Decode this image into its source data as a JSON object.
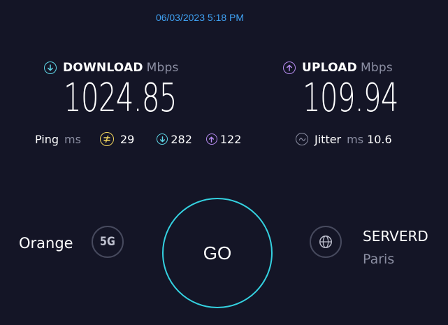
{
  "timestamp": "06/03/2023 5:18 PM",
  "download": {
    "label": "DOWNLOAD",
    "unit": "Mbps",
    "value": "1024.85",
    "icon": "arrow-down-circle-icon",
    "color": "#5fd6e6"
  },
  "upload": {
    "label": "UPLOAD",
    "unit": "Mbps",
    "value": "109.94",
    "icon": "arrow-up-circle-icon",
    "color": "#b68cf0"
  },
  "ping": {
    "label": "Ping",
    "unit": "ms",
    "idle_value": "29",
    "idle_icon": "idle-latency-icon",
    "idle_color": "#f1d55e",
    "download_value": "282",
    "upload_value": "122"
  },
  "jitter": {
    "label": "Jitter",
    "unit": "ms",
    "value": "10.6",
    "icon": "wave-icon"
  },
  "provider": {
    "name": "Orange",
    "network_badge": "5G"
  },
  "go_button": {
    "label": "GO",
    "ring_color": "#34d1e0"
  },
  "server": {
    "name": "SERVERD",
    "location": "Paris",
    "icon": "globe-icon"
  }
}
